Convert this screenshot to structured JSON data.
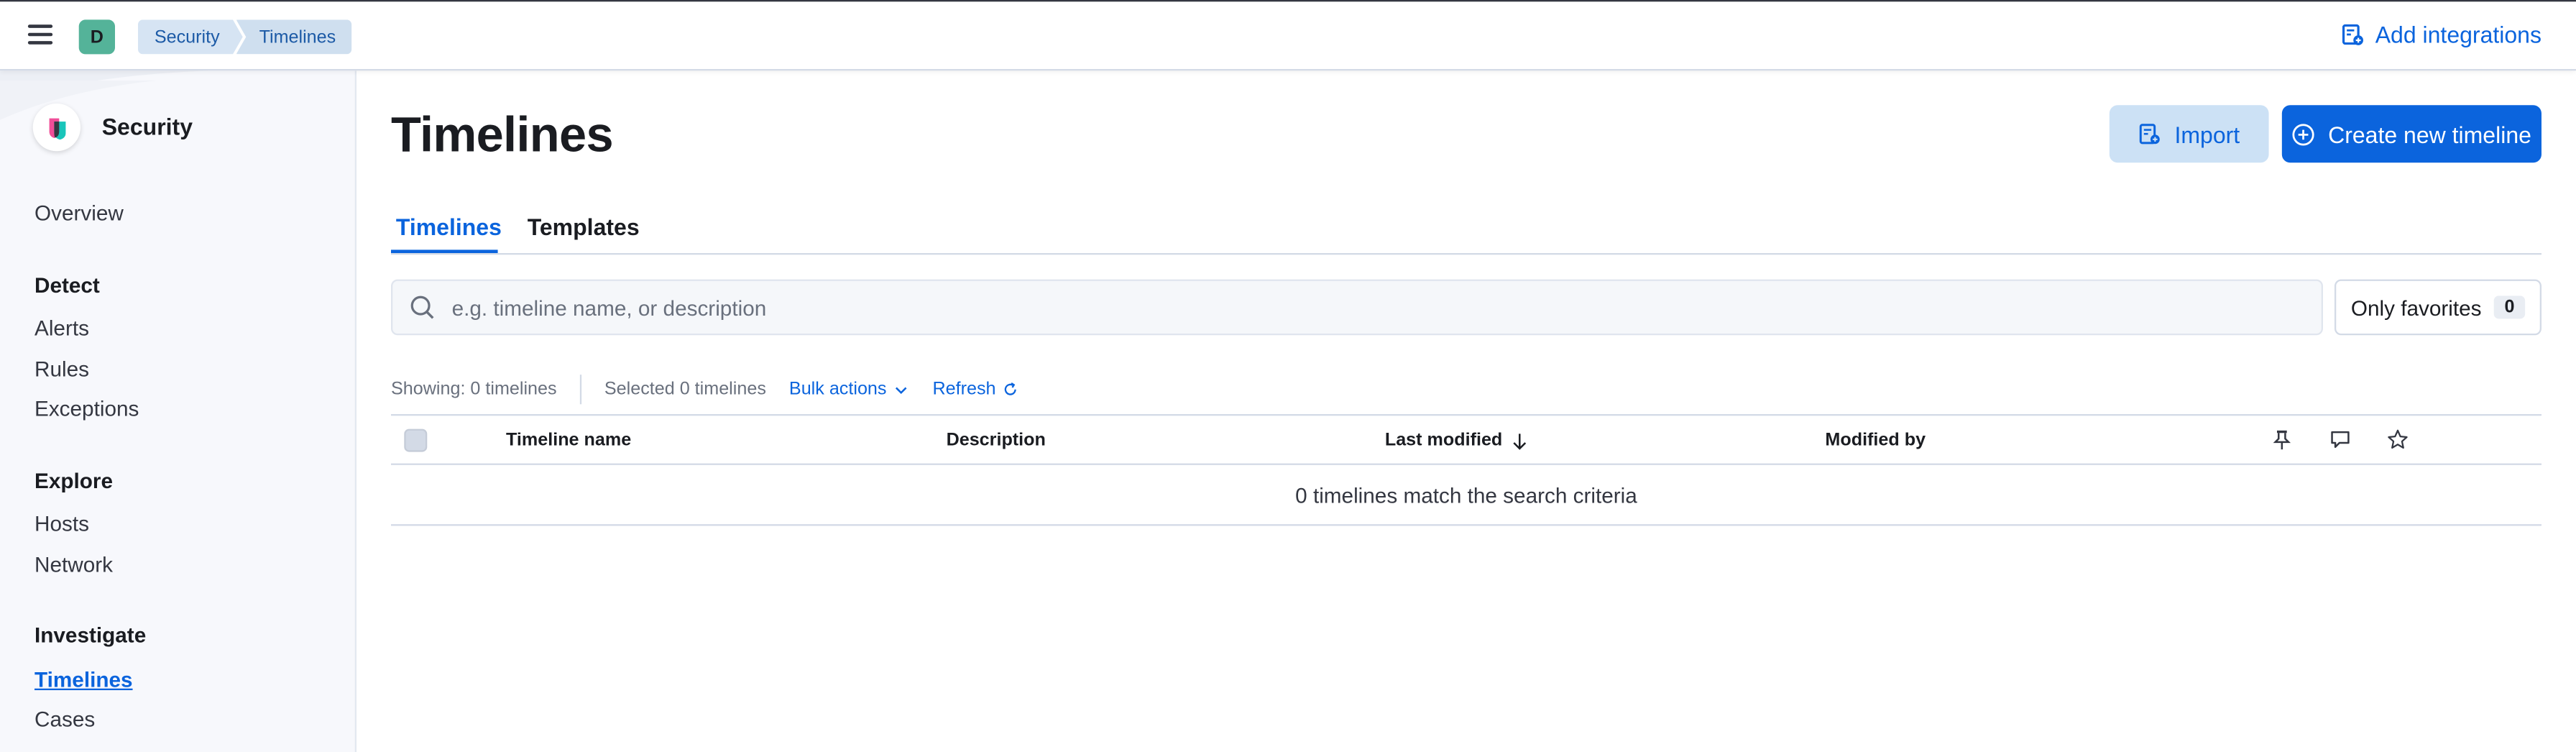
{
  "header": {
    "space_initial": "D",
    "breadcrumbs": [
      "Security",
      "Timelines"
    ],
    "add_integrations": "Add integrations"
  },
  "sidebar": {
    "title": "Security",
    "overview": "Overview",
    "groups": [
      {
        "label": "Detect",
        "items": [
          "Alerts",
          "Rules",
          "Exceptions"
        ]
      },
      {
        "label": "Explore",
        "items": [
          "Hosts",
          "Network"
        ]
      },
      {
        "label": "Investigate",
        "items": [
          "Timelines",
          "Cases"
        ]
      }
    ],
    "active_item": "Timelines"
  },
  "main": {
    "title": "Timelines",
    "import_label": "Import",
    "create_label": "Create new timeline",
    "tabs": [
      {
        "label": "Timelines",
        "selected": true
      },
      {
        "label": "Templates",
        "selected": false
      }
    ],
    "search_placeholder": "e.g. timeline name, or description",
    "only_favorites_label": "Only favorites",
    "favorites_count": "0",
    "showing_text": "Showing: 0 timelines",
    "selected_text": "Selected 0 timelines",
    "bulk_actions": "Bulk actions",
    "refresh": "Refresh",
    "table": {
      "columns": [
        "Timeline name",
        "Description",
        "Last modified",
        "Modified by"
      ],
      "sort_column": "Last modified",
      "sort_direction": "descending",
      "icon_columns": [
        "pin-icon",
        "comment-icon",
        "star-icon"
      ],
      "empty_message": "0 timelines match the search criteria"
    }
  },
  "colors": {
    "accent": "#0b64dd",
    "breadcrumb_bg": "#d6e4f3",
    "avatar": "#54b399"
  }
}
